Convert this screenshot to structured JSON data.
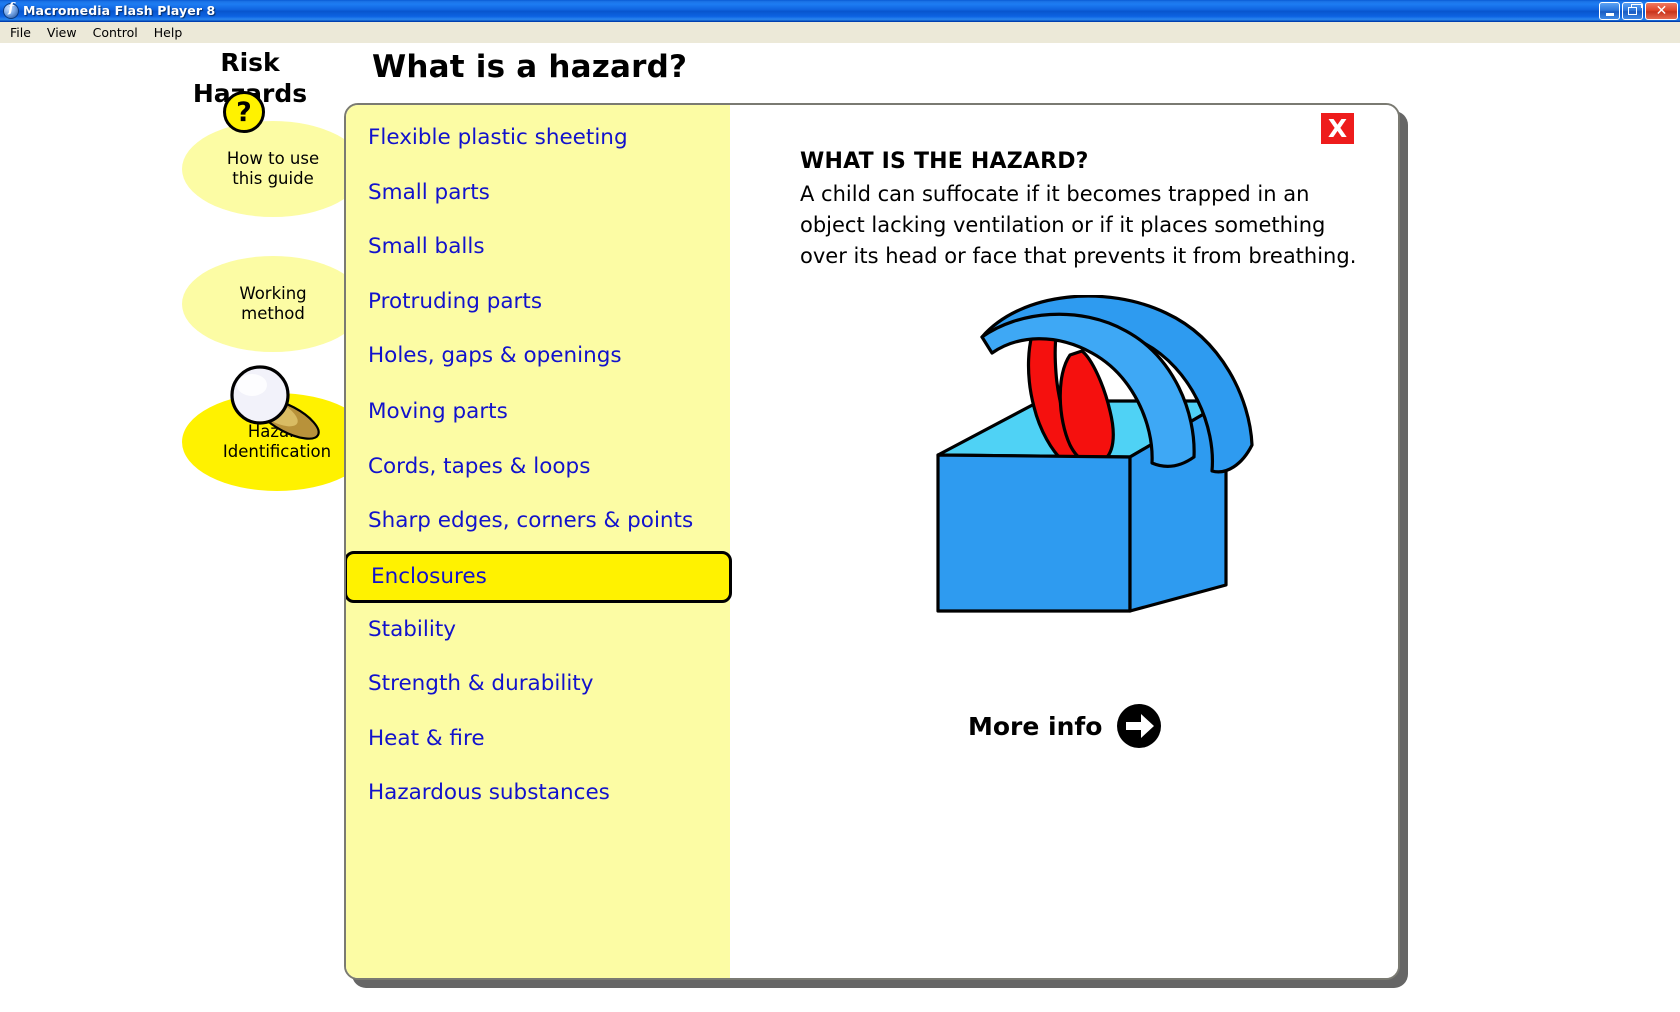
{
  "window": {
    "title": "Macromedia Flash Player 8",
    "app_icon": "flash-player-icon",
    "buttons": {
      "minimize": "minimize-icon",
      "restore": "restore-icon",
      "close": "close-icon"
    },
    "menu": [
      "File",
      "View",
      "Control",
      "Help"
    ]
  },
  "sidebar": {
    "title": "Risk\nHazards",
    "help_badge": "?",
    "items": [
      {
        "label": "How to use\nthis guide",
        "state": "inactive",
        "color": "#FCFCA4"
      },
      {
        "label": "Working\nmethod",
        "state": "inactive",
        "color": "#FCFCA4"
      },
      {
        "label": "Hazard\nIdentification",
        "state": "active",
        "color": "#FFF200"
      }
    ]
  },
  "page": {
    "title": "What is a hazard?"
  },
  "hazard_list": {
    "selected": "Enclosures",
    "items": [
      "Flexible plastic sheeting",
      "Small parts",
      "Small balls",
      "Protruding parts",
      "Holes, gaps & openings",
      "Moving parts",
      "Cords, tapes & loops",
      "Sharp edges, corners & points",
      "Enclosures",
      "Stability",
      "Strength & durability",
      "Heat & fire",
      "Hazardous substances"
    ]
  },
  "detail": {
    "close_label": "X",
    "heading": "WHAT IS THE HAZARD?",
    "body": "A child can suffocate if it becomes trapped in an object lacking ventilation or if it places something over its head or face that prevents it from breathing.",
    "illustration": "child-trapped-in-toy-chest",
    "more_info_label": "More info"
  },
  "colors": {
    "link_blue": "#1212CC",
    "panel_yellow": "#FCFCA4",
    "highlight_yellow": "#FFF200",
    "close_red": "#EE1C1C",
    "shadow_grey": "#666666",
    "title_blue": "#0E62DE"
  }
}
